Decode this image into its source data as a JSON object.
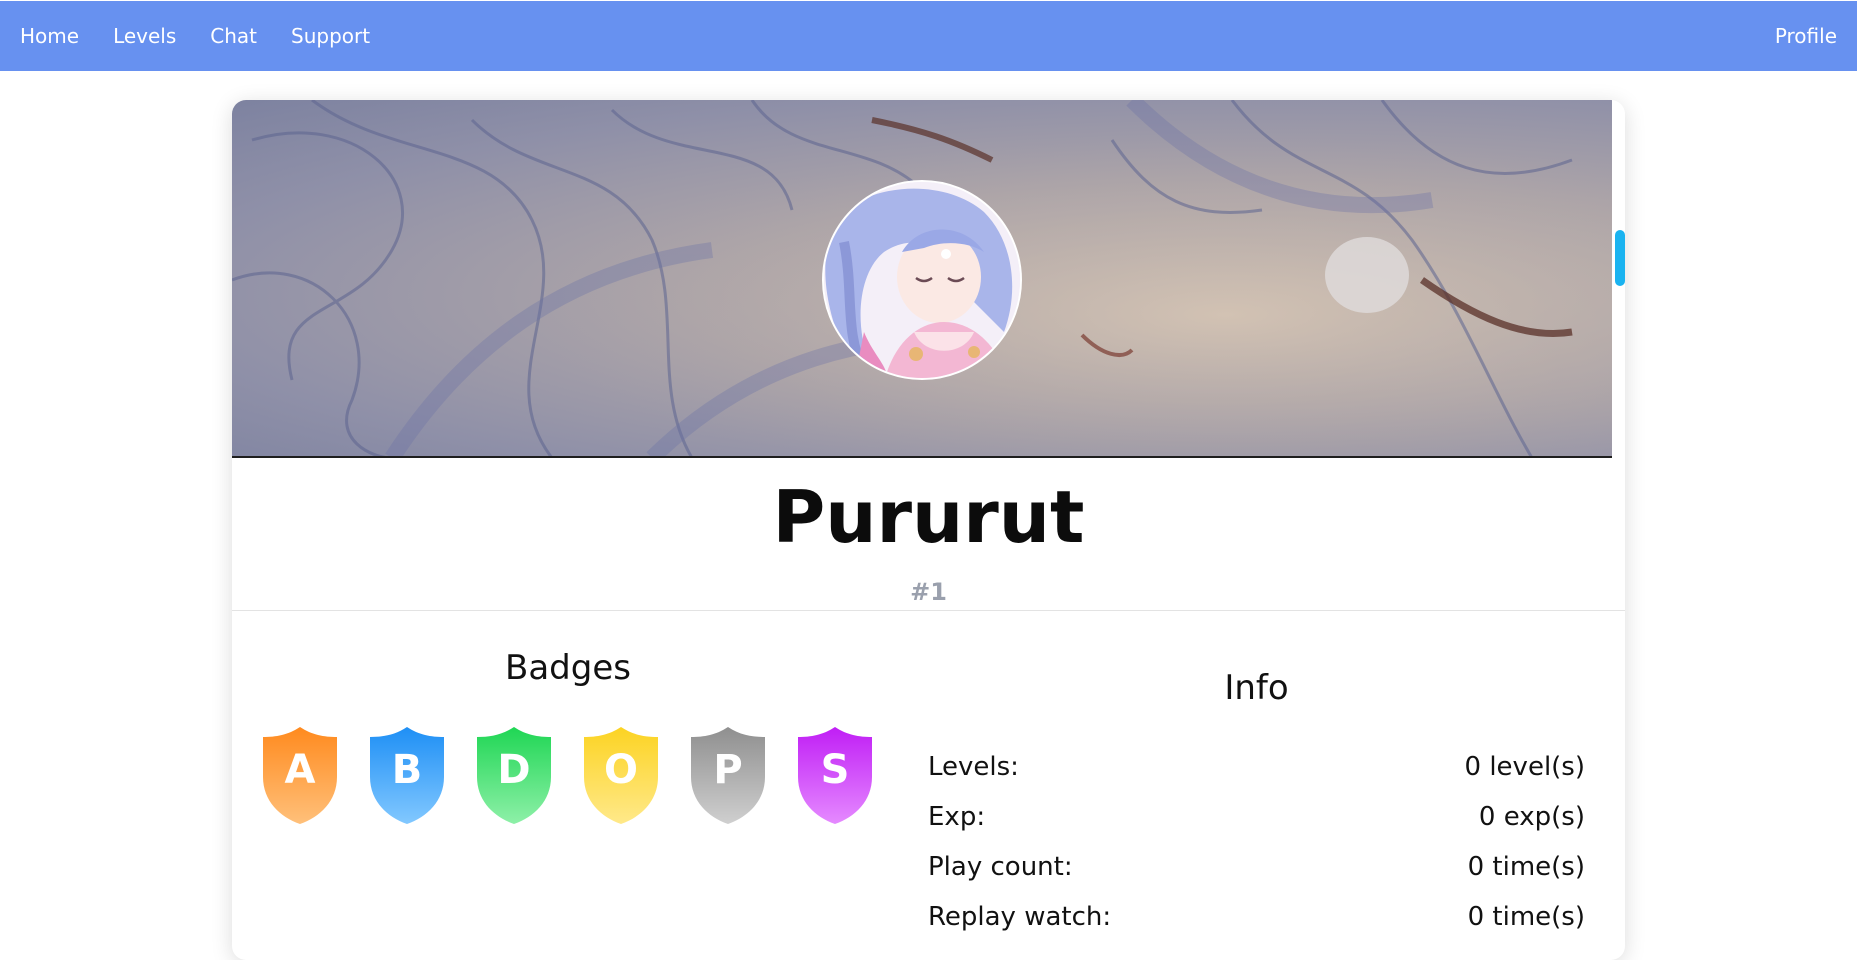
{
  "nav": {
    "items": [
      "Home",
      "Levels",
      "Chat",
      "Support"
    ],
    "profile": "Profile"
  },
  "profile": {
    "name": "Pururut",
    "rank": "#1"
  },
  "badges": {
    "title": "Badges",
    "items": [
      {
        "letter": "A",
        "color_top": "#ff8a1e",
        "color_bottom": "#ffc07a"
      },
      {
        "letter": "B",
        "color_top": "#1e8ff5",
        "color_bottom": "#82c8ff"
      },
      {
        "letter": "D",
        "color_top": "#1fd654",
        "color_bottom": "#8ef0a8"
      },
      {
        "letter": "O",
        "color_top": "#fcd322",
        "color_bottom": "#ffe98a"
      },
      {
        "letter": "P",
        "color_top": "#8f8f8f",
        "color_bottom": "#cfcfcf"
      },
      {
        "letter": "S",
        "color_top": "#c01ef5",
        "color_bottom": "#e58aff"
      }
    ]
  },
  "info": {
    "title": "Info",
    "rows": [
      {
        "label": "Levels:",
        "value": "0 level(s)"
      },
      {
        "label": "Exp:",
        "value": "0 exp(s)"
      },
      {
        "label": "Play count:",
        "value": "0 time(s)"
      },
      {
        "label": "Replay watch:",
        "value": "0 time(s)"
      }
    ]
  },
  "colors": {
    "nav": "#6791f0",
    "scrollbar": "#1ab3f0",
    "rank": "#9aa0ad"
  }
}
